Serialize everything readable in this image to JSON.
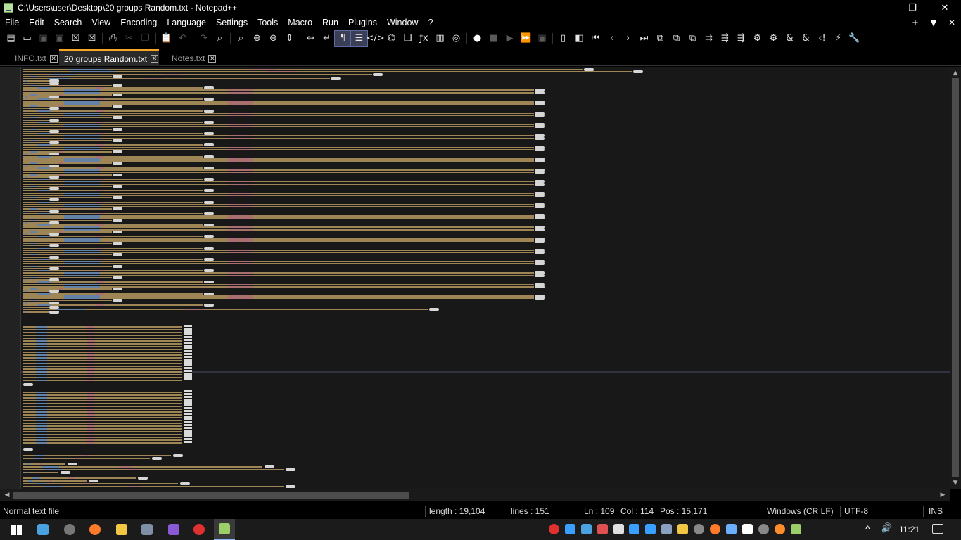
{
  "window": {
    "title": "C:\\Users\\user\\Desktop\\20 groups Random.txt - Notepad++",
    "minimize_glyph": "—",
    "restore_glyph": "❐",
    "close_glyph": "✕"
  },
  "menu": {
    "items": [
      "File",
      "Edit",
      "Search",
      "View",
      "Encoding",
      "Language",
      "Settings",
      "Tools",
      "Macro",
      "Run",
      "Plugins",
      "Window",
      "?"
    ],
    "right_add": "+",
    "right_dropdown": "▼",
    "right_close": "✕"
  },
  "toolbar": {
    "icons": [
      {
        "name": "new-file-icon",
        "glyph": "▤"
      },
      {
        "name": "open-file-icon",
        "glyph": "▭"
      },
      {
        "name": "save-icon",
        "glyph": "▣",
        "dim": true
      },
      {
        "name": "save-all-icon",
        "glyph": "▣",
        "dim": true
      },
      {
        "name": "close-file-icon",
        "glyph": "☒"
      },
      {
        "name": "close-all-icon",
        "glyph": "☒"
      },
      {
        "name": "print-icon",
        "glyph": "⎙"
      },
      {
        "name": "cut-icon",
        "glyph": "✂",
        "dim": true
      },
      {
        "name": "copy-icon",
        "glyph": "❐",
        "dim": true
      },
      {
        "name": "paste-icon",
        "glyph": "📋"
      },
      {
        "name": "undo-icon",
        "glyph": "↶",
        "dim": true
      },
      {
        "name": "redo-icon",
        "glyph": "↷",
        "dim": true
      },
      {
        "name": "find-icon",
        "glyph": "⌕"
      },
      {
        "name": "replace-icon",
        "glyph": "⌕"
      },
      {
        "name": "zoom-in-icon",
        "glyph": "⊕"
      },
      {
        "name": "zoom-out-icon",
        "glyph": "⊖"
      },
      {
        "name": "sync-vertical-icon",
        "glyph": "⇕"
      },
      {
        "name": "sync-horizontal-icon",
        "glyph": "⇔"
      },
      {
        "name": "word-wrap-icon",
        "glyph": "↵"
      },
      {
        "name": "show-all-characters-icon",
        "glyph": "¶",
        "active": true
      },
      {
        "name": "indent-guide-icon",
        "glyph": "☰",
        "active": true
      },
      {
        "name": "xml-tag-icon",
        "glyph": "</>"
      },
      {
        "name": "document-map-icon",
        "glyph": "⌬"
      },
      {
        "name": "document-list-icon",
        "glyph": "❏"
      },
      {
        "name": "function-list-icon",
        "glyph": "ƒx"
      },
      {
        "name": "folder-as-workspace-icon",
        "glyph": "▥"
      },
      {
        "name": "monitoring-icon",
        "glyph": "◎"
      },
      {
        "name": "record-macro-icon",
        "glyph": "●"
      },
      {
        "name": "stop-macro-icon",
        "glyph": "■",
        "dim": true
      },
      {
        "name": "play-macro-icon",
        "glyph": "▶",
        "dim": true
      },
      {
        "name": "run-macro-multiple-icon",
        "glyph": "⏩"
      },
      {
        "name": "save-macro-icon",
        "glyph": "▣",
        "dim": true
      },
      {
        "name": "plugin-doc-icon",
        "glyph": "▯"
      },
      {
        "name": "plugin-bookmark-icon",
        "glyph": "◧"
      },
      {
        "name": "first-icon",
        "glyph": "⏮"
      },
      {
        "name": "previous-icon",
        "glyph": "‹"
      },
      {
        "name": "next-icon",
        "glyph": "›"
      },
      {
        "name": "last-icon",
        "glyph": "⏭"
      },
      {
        "name": "plugin-a-icon",
        "glyph": "⧉"
      },
      {
        "name": "plugin-b-icon",
        "glyph": "⧉"
      },
      {
        "name": "plugin-c-icon",
        "glyph": "⧉"
      },
      {
        "name": "plugin-d-icon",
        "glyph": "⇉"
      },
      {
        "name": "plugin-e-icon",
        "glyph": "⇶"
      },
      {
        "name": "plugin-f-icon",
        "glyph": "⇶"
      },
      {
        "name": "plugin-g-icon",
        "glyph": "⚙"
      },
      {
        "name": "plugin-h-icon",
        "glyph": "⚙"
      },
      {
        "name": "plugin-i-icon",
        "glyph": "&"
      },
      {
        "name": "plugin-j-icon",
        "glyph": "&"
      },
      {
        "name": "plugin-k-icon",
        "glyph": "‹!"
      },
      {
        "name": "plugin-l-icon",
        "glyph": "⚡"
      },
      {
        "name": "settings-wrench-icon",
        "glyph": "🔧"
      }
    ]
  },
  "tabs": [
    {
      "label": "INFO.txt",
      "active": false
    },
    {
      "label": "20 groups Random.txt",
      "active": true
    },
    {
      "label": "Notes.txt",
      "active": false
    }
  ],
  "scrollbar": {
    "up": "▲",
    "down": "▼",
    "left": "◀",
    "right": "▶"
  },
  "status": {
    "file_type": "Normal text file",
    "length": "length : 19,104",
    "lines": "lines : 151",
    "ln": "Ln : 109",
    "col": "Col : 114",
    "pos": "Pos : 15,171",
    "eol": "Windows (CR LF)",
    "encoding": "UTF-8",
    "mode": "INS"
  },
  "taskbar": {
    "time": "11:21",
    "apps": [
      {
        "name": "windows-start-icon",
        "color": "#ffffff"
      },
      {
        "name": "desktop-app-icon",
        "color": "#4aa3e0"
      },
      {
        "name": "x-app-icon",
        "color": "#777777"
      },
      {
        "name": "firefox-icon",
        "color": "#ff7a2a"
      },
      {
        "name": "file-explorer-icon",
        "color": "#f2c744"
      },
      {
        "name": "calculator-icon",
        "color": "#7f8fa6"
      },
      {
        "name": "visual-studio-icon",
        "color": "#8a5ad6"
      },
      {
        "name": "target-app-icon",
        "color": "#e03030"
      },
      {
        "name": "notepadpp-icon",
        "color": "#9ccf6a"
      }
    ],
    "tray": [
      {
        "name": "tray-target-icon",
        "color": "#e03030"
      },
      {
        "name": "tray-download-icon",
        "color": "#3aa0ff"
      },
      {
        "name": "tray-monitor-icon",
        "color": "#4aa3e0"
      },
      {
        "name": "tray-red-app-icon",
        "color": "#e05050"
      },
      {
        "name": "tray-document-icon",
        "color": "#e0e0e0"
      },
      {
        "name": "tray-music-icon",
        "color": "#3aa0ff"
      },
      {
        "name": "tray-play-icon",
        "color": "#3aa0ff"
      },
      {
        "name": "tray-image-icon",
        "color": "#8aa0c0"
      },
      {
        "name": "tray-folder-icon",
        "color": "#f2c744"
      },
      {
        "name": "tray-x-icon",
        "color": "#888888"
      },
      {
        "name": "tray-firefox-icon",
        "color": "#ff7a2a"
      },
      {
        "name": "tray-keyboard-icon",
        "color": "#6ab0ff"
      },
      {
        "name": "tray-upload-icon",
        "color": "#ffffff"
      },
      {
        "name": "tray-circle-icon",
        "color": "#888888"
      },
      {
        "name": "tray-orange-app-icon",
        "color": "#ff8c2a"
      },
      {
        "name": "tray-notepadpp-icon",
        "color": "#9ccf6a"
      }
    ],
    "chevron": "^",
    "volume_glyph": "🔊"
  }
}
